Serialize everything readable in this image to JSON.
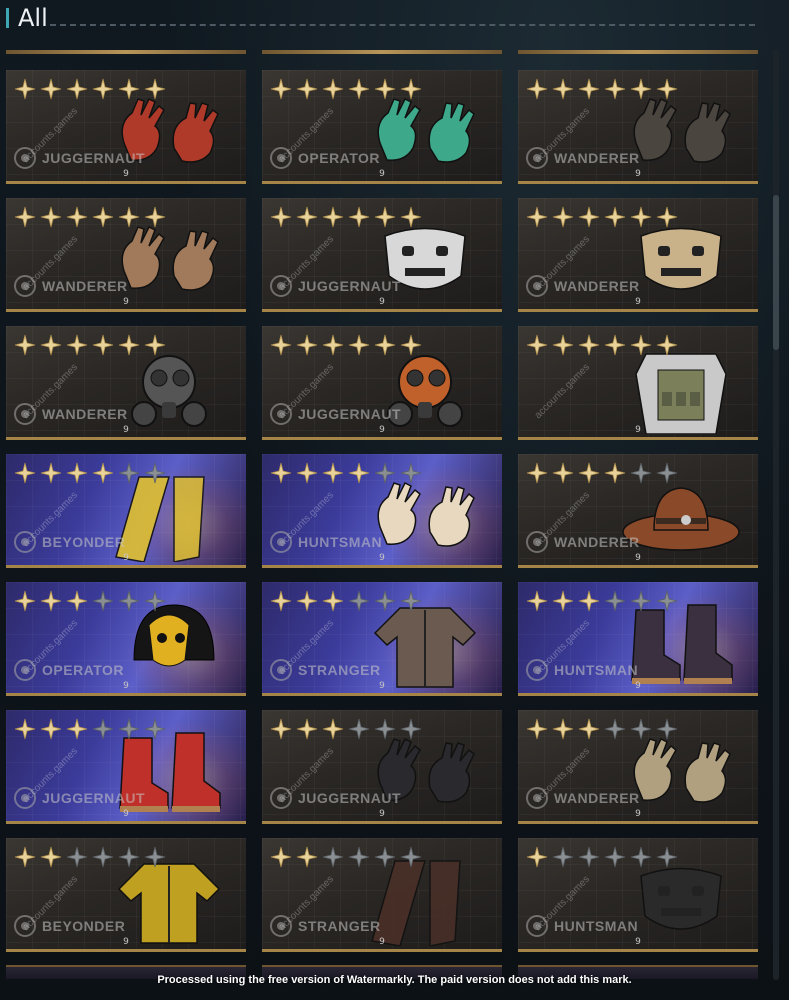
{
  "header": {
    "title": "All"
  },
  "watermark": {
    "text": "accounts.games"
  },
  "footer": {
    "note": "Processed using the free version of Watermarkly. The paid version does not add this mark."
  },
  "colors": {
    "accent": "#3fa7b3",
    "gold": "#a58448",
    "star_on": "#e9d39a",
    "star_off": "#8a8f93"
  },
  "items": [
    {
      "faction": "JUGGERNAUT",
      "level": "9",
      "stars_on": 6,
      "stars_total": 6,
      "style": "dark",
      "art": "gloves-icon",
      "tint": "#b03a2a"
    },
    {
      "faction": "OPERATOR",
      "level": "9",
      "stars_on": 6,
      "stars_total": 6,
      "style": "dark",
      "art": "gloves-icon",
      "tint": "#3da88a"
    },
    {
      "faction": "WANDERER",
      "level": "9",
      "stars_on": 6,
      "stars_total": 6,
      "style": "dark",
      "art": "gloves-icon",
      "tint": "#4b4540"
    },
    {
      "faction": "WANDERER",
      "level": "9",
      "stars_on": 6,
      "stars_total": 6,
      "style": "dark",
      "art": "gloves-icon",
      "tint": "#a07a5a"
    },
    {
      "faction": "JUGGERNAUT",
      "level": "9",
      "stars_on": 6,
      "stars_total": 6,
      "style": "dark",
      "art": "mask-icon",
      "tint": "#d8d8d8"
    },
    {
      "faction": "WANDERER",
      "level": "9",
      "stars_on": 6,
      "stars_total": 6,
      "style": "dark",
      "art": "mask-icon",
      "tint": "#c9b28a"
    },
    {
      "faction": "WANDERER",
      "level": "9",
      "stars_on": 6,
      "stars_total": 6,
      "style": "dark",
      "art": "gasmask-icon",
      "tint": "#555555"
    },
    {
      "faction": "JUGGERNAUT",
      "level": "9",
      "stars_on": 6,
      "stars_total": 6,
      "style": "dark",
      "art": "gasmask-icon",
      "tint": "#c0602a"
    },
    {
      "faction": "",
      "level": "9",
      "stars_on": 6,
      "stars_total": 6,
      "style": "dark",
      "art": "vest-icon",
      "tint": "#7b7f5a"
    },
    {
      "faction": "BEYONDER",
      "level": "9",
      "stars_on": 4,
      "stars_total": 6,
      "style": "purple",
      "art": "pants-icon",
      "tint": "#e0c030"
    },
    {
      "faction": "HUNTSMAN",
      "level": "9",
      "stars_on": 4,
      "stars_total": 6,
      "style": "purple",
      "art": "gloves-icon",
      "tint": "#e8d8c0"
    },
    {
      "faction": "WANDERER",
      "level": "9",
      "stars_on": 4,
      "stars_total": 6,
      "style": "dark",
      "art": "hat-icon",
      "tint": "#8a4a2a"
    },
    {
      "faction": "OPERATOR",
      "level": "9",
      "stars_on": 3,
      "stars_total": 6,
      "style": "purple",
      "art": "helmet-icon",
      "tint": "#e0b020"
    },
    {
      "faction": "STRANGER",
      "level": "9",
      "stars_on": 3,
      "stars_total": 6,
      "style": "purple",
      "art": "jacket-icon",
      "tint": "#6a5a50"
    },
    {
      "faction": "HUNTSMAN",
      "level": "9",
      "stars_on": 3,
      "stars_total": 6,
      "style": "purple",
      "art": "boots-icon",
      "tint": "#3a3040"
    },
    {
      "faction": "JUGGERNAUT",
      "level": "9",
      "stars_on": 3,
      "stars_total": 6,
      "style": "purple",
      "art": "boots-icon",
      "tint": "#c0302a"
    },
    {
      "faction": "JUGGERNAUT",
      "level": "9",
      "stars_on": 3,
      "stars_total": 6,
      "style": "dark",
      "art": "gloves-icon",
      "tint": "#2a2a2e"
    },
    {
      "faction": "WANDERER",
      "level": "9",
      "stars_on": 3,
      "stars_total": 6,
      "style": "dark",
      "art": "gloves-icon",
      "tint": "#b0a080"
    },
    {
      "faction": "BEYONDER",
      "level": "9",
      "stars_on": 2,
      "stars_total": 6,
      "style": "dark",
      "art": "jacket-icon",
      "tint": "#c0a020"
    },
    {
      "faction": "STRANGER",
      "level": "9",
      "stars_on": 2,
      "stars_total": 6,
      "style": "dark",
      "art": "pants-icon",
      "tint": "#4a3028"
    },
    {
      "faction": "HUNTSMAN",
      "level": "9",
      "stars_on": 1,
      "stars_total": 6,
      "style": "dark",
      "art": "mask-icon",
      "tint": "#2a2a2a"
    }
  ]
}
